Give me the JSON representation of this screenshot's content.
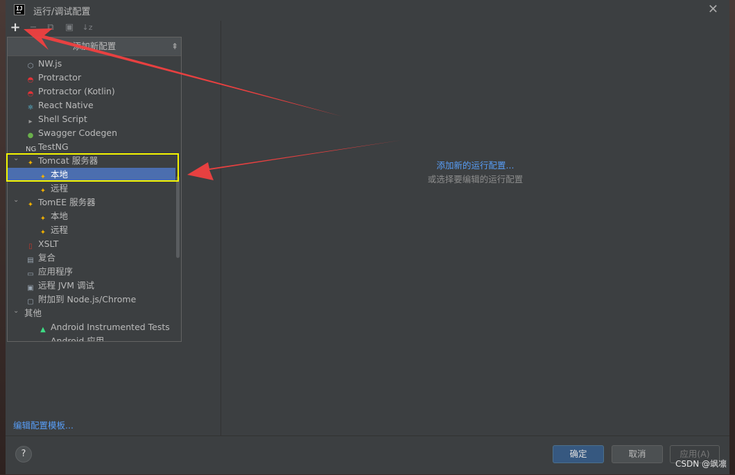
{
  "window": {
    "title": "运行/调试配置",
    "app_icon_text": "IJ"
  },
  "toolbar": {
    "add": "+",
    "remove": "−",
    "copy": "⧉",
    "move": "▣",
    "sort": "↓z"
  },
  "popup": {
    "header": "添加新配置",
    "items": [
      {
        "label": "NW.js",
        "icon": "nwjs-icon",
        "color": "#9aa6b2"
      },
      {
        "label": "Protractor",
        "icon": "protractor-icon",
        "color": "#e23237"
      },
      {
        "label": "Protractor (Kotlin)",
        "icon": "protractor-icon",
        "color": "#e23237"
      },
      {
        "label": "React Native",
        "icon": "react-icon",
        "color": "#61dafb"
      },
      {
        "label": "Shell Script",
        "icon": "shell-icon",
        "color": "#9a9a9a"
      },
      {
        "label": "Swagger Codegen",
        "icon": "swagger-icon",
        "color": "#6ab04c"
      },
      {
        "label": "TestNG",
        "icon": "testng-icon",
        "color": "#d0d0d0"
      },
      {
        "label": "Tomcat 服务器",
        "icon": "tomcat-icon",
        "color": "#f0b000"
      },
      {
        "label": "本地",
        "icon": "tomcat-icon",
        "color": "#f0b000"
      },
      {
        "label": "远程",
        "icon": "tomcat-icon",
        "color": "#f0b000"
      },
      {
        "label": "TomEE 服务器",
        "icon": "tomcat-icon",
        "color": "#f0b000"
      },
      {
        "label": "本地",
        "icon": "tomcat-icon",
        "color": "#f0b000"
      },
      {
        "label": "远程",
        "icon": "tomcat-icon",
        "color": "#f0b000"
      },
      {
        "label": "XSLT",
        "icon": "xslt-icon",
        "color": "#c0392b"
      },
      {
        "label": "复合",
        "icon": "compound-icon",
        "color": "#9aa6b2"
      },
      {
        "label": "应用程序",
        "icon": "application-icon",
        "color": "#9aa6b2"
      },
      {
        "label": "远程 JVM 调试",
        "icon": "remote-jvm-icon",
        "color": "#9aa6b2"
      },
      {
        "label": "附加到 Node.js/Chrome",
        "icon": "nodejs-icon",
        "color": "#9aa6b2"
      },
      {
        "label": "其他",
        "icon": "",
        "color": ""
      },
      {
        "label": "Android Instrumented Tests",
        "icon": "android-icon",
        "color": "#3ddc84"
      },
      {
        "label": "Android 应用",
        "icon": "android-icon",
        "color": "#3ddc84"
      }
    ]
  },
  "left": {
    "edit_templates": "编辑配置模板..."
  },
  "right": {
    "add_link": "添加新的运行配置...",
    "hint": "或选择要编辑的运行配置"
  },
  "footer": {
    "help": "?",
    "ok": "确定",
    "cancel": "取消",
    "apply": "应用(A)"
  },
  "watermark": "CSDN @飒凛",
  "colors": {
    "accent": "#589df6",
    "selection": "#4b6eaf",
    "annotation_arrow": "#f04040",
    "annotation_box": "#f5f500"
  }
}
